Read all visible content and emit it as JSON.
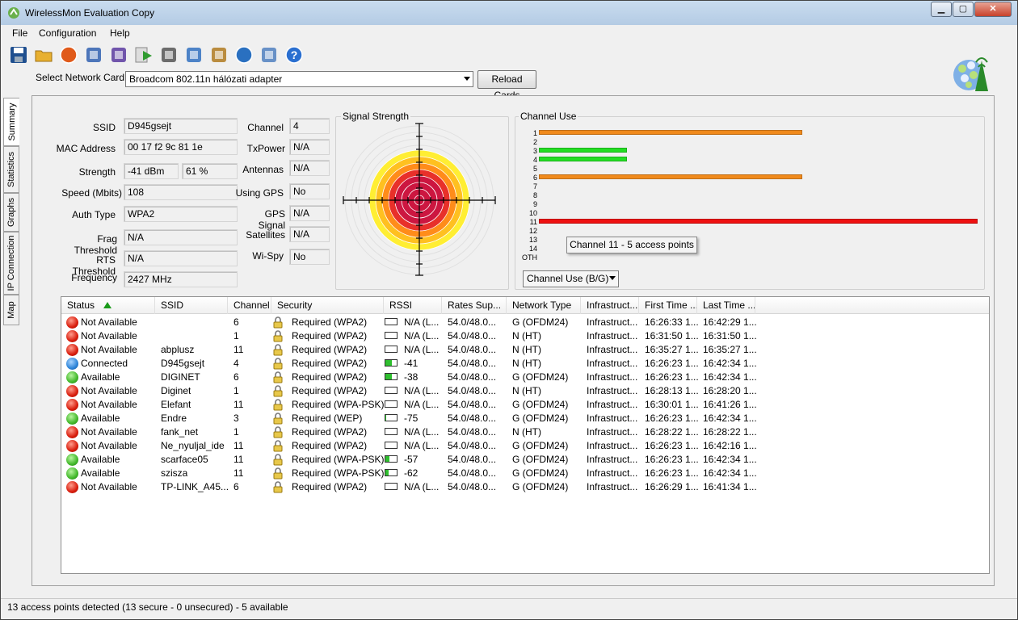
{
  "window": {
    "title": "WirelessMon Evaluation Copy",
    "min": "▁",
    "max": "▢",
    "close": "✕"
  },
  "menu": [
    "File",
    "Configuration",
    "Help"
  ],
  "toolbar": {
    "icons": [
      "save-icon",
      "open-folder-icon",
      "record-icon",
      "network-cards-icon",
      "network-cards-alt-icon",
      "play-icon",
      "print-icon",
      "checklist-icon",
      "clipboard-icon",
      "globe-icon",
      "info-bubble-icon",
      "help-icon"
    ]
  },
  "network_card": {
    "label": "Select Network Card",
    "value": "Broadcom 802.11n hálózati adapter",
    "reload": "Reload Cards"
  },
  "tabs": [
    "Summary",
    "Statistics",
    "Graphs",
    "IP Connection",
    "Map"
  ],
  "summary": {
    "ssid_label": "SSID",
    "ssid": "D945gsejt",
    "mac_label": "MAC Address",
    "mac": "00 17 f2 9c 81 1e",
    "strength_label": "Strength",
    "strength_dbm": "-41 dBm",
    "strength_pct": "61 %",
    "speed_label": "Speed (Mbits)",
    "speed": "108",
    "auth_label": "Auth Type",
    "auth": "WPA2",
    "frag_label": "Frag Threshold",
    "frag": "N/A",
    "rts_label": "RTS Threshold",
    "rts": "N/A",
    "freq_label": "Frequency",
    "freq": "2427 MHz",
    "channel_label": "Channel",
    "channel": "4",
    "txpower_label": "TxPower",
    "txpower": "N/A",
    "antennas_label": "Antennas",
    "antennas": "N/A",
    "gps_label": "Using GPS",
    "gps": "No",
    "gpssig_label": "GPS Signal",
    "gpssig": "N/A",
    "sat_label": "Satellites",
    "sat": "N/A",
    "wispy_label": "Wi-Spy",
    "wispy": "No"
  },
  "signal": {
    "title": "Signal Strength"
  },
  "channel_use": {
    "title": "Channel Use",
    "labels": [
      "1",
      "2",
      "3",
      "4",
      "5",
      "6",
      "7",
      "8",
      "9",
      "10",
      "11",
      "12",
      "13",
      "14",
      "OTH"
    ],
    "bars": [
      {
        "ch": "1",
        "count": 3,
        "color": "#f08a1c"
      },
      {
        "ch": "3",
        "count": 1,
        "color": "#22dd22"
      },
      {
        "ch": "4",
        "count": 1,
        "color": "#22dd22"
      },
      {
        "ch": "6",
        "count": 3,
        "color": "#f08a1c"
      },
      {
        "ch": "11",
        "count": 5,
        "color": "#ee1111"
      }
    ],
    "max_count": 5,
    "tooltip": "Channel 11 - 5 access points",
    "mode": "Channel Use (B/G)"
  },
  "list": {
    "columns": [
      "Status",
      "SSID",
      "Channel",
      "Security",
      "RSSI",
      "Rates Sup...",
      "Network Type",
      "Infrastruct...",
      "First Time ...",
      "Last Time ..."
    ],
    "rows": [
      {
        "st": "red",
        "status": "Not Available",
        "ssid": "",
        "ch": "6",
        "sec": "Required (WPA2)",
        "rssi_level": 0,
        "rssi": "N/A (L...",
        "rates": "54.0/48.0...",
        "net": "G (OFDM24)",
        "infra": "Infrastruct...",
        "first": "16:26:33 1...",
        "last": "16:42:29 1..."
      },
      {
        "st": "red",
        "status": "Not Available",
        "ssid": "",
        "ch": "1",
        "sec": "Required (WPA2)",
        "rssi_level": 0,
        "rssi": "N/A (L...",
        "rates": "54.0/48.0...",
        "net": "N (HT)",
        "infra": "Infrastruct...",
        "first": "16:31:50 1...",
        "last": "16:31:50 1..."
      },
      {
        "st": "red",
        "status": "Not Available",
        "ssid": "abplusz",
        "ch": "11",
        "sec": "Required (WPA2)",
        "rssi_level": 0,
        "rssi": "N/A (L...",
        "rates": "54.0/48.0...",
        "net": "N (HT)",
        "infra": "Infrastruct...",
        "first": "16:35:27 1...",
        "last": "16:35:27 1..."
      },
      {
        "st": "blue",
        "status": "Connected",
        "ssid": "D945gsejt",
        "ch": "4",
        "sec": "Required (WPA2)",
        "rssi_level": 0.6,
        "rssi": "-41",
        "rates": "54.0/48.0...",
        "net": "N (HT)",
        "infra": "Infrastruct...",
        "first": "16:26:23 1...",
        "last": "16:42:34 1..."
      },
      {
        "st": "green",
        "status": "Available",
        "ssid": "DIGINET",
        "ch": "6",
        "sec": "Required (WPA2)",
        "rssi_level": 0.55,
        "rssi": "-38",
        "rates": "54.0/48.0...",
        "net": "G (OFDM24)",
        "infra": "Infrastruct...",
        "first": "16:26:23 1...",
        "last": "16:42:34 1..."
      },
      {
        "st": "red",
        "status": "Not Available",
        "ssid": "Diginet",
        "ch": "1",
        "sec": "Required (WPA2)",
        "rssi_level": 0,
        "rssi": "N/A (L...",
        "rates": "54.0/48.0...",
        "net": "N (HT)",
        "infra": "Infrastruct...",
        "first": "16:28:13 1...",
        "last": "16:28:20 1..."
      },
      {
        "st": "red",
        "status": "Not Available",
        "ssid": "Elefant",
        "ch": "11",
        "sec": "Required (WPA-PSK)",
        "rssi_level": 0,
        "rssi": "N/A (L...",
        "rates": "54.0/48.0...",
        "net": "G (OFDM24)",
        "infra": "Infrastruct...",
        "first": "16:30:01 1...",
        "last": "16:41:26 1..."
      },
      {
        "st": "green",
        "status": "Available",
        "ssid": "Endre",
        "ch": "3",
        "sec": "Required (WEP)",
        "rssi_level": 0.1,
        "rssi": "-75",
        "rates": "54.0/48.0...",
        "net": "G (OFDM24)",
        "infra": "Infrastruct...",
        "first": "16:26:23 1...",
        "last": "16:42:34 1..."
      },
      {
        "st": "red",
        "status": "Not Available",
        "ssid": "fank_net",
        "ch": "1",
        "sec": "Required (WPA2)",
        "rssi_level": 0,
        "rssi": "N/A (L...",
        "rates": "54.0/48.0...",
        "net": "N (HT)",
        "infra": "Infrastruct...",
        "first": "16:28:22 1...",
        "last": "16:28:22 1..."
      },
      {
        "st": "red",
        "status": "Not Available",
        "ssid": "Ne_nyuljal_ide",
        "ch": "11",
        "sec": "Required (WPA2)",
        "rssi_level": 0,
        "rssi": "N/A (L...",
        "rates": "54.0/48.0...",
        "net": "G (OFDM24)",
        "infra": "Infrastruct...",
        "first": "16:26:23 1...",
        "last": "16:42:16 1..."
      },
      {
        "st": "green",
        "status": "Available",
        "ssid": "scarface05",
        "ch": "11",
        "sec": "Required (WPA-PSK)",
        "rssi_level": 0.35,
        "rssi": "-57",
        "rates": "54.0/48.0...",
        "net": "G (OFDM24)",
        "infra": "Infrastruct...",
        "first": "16:26:23 1...",
        "last": "16:42:34 1..."
      },
      {
        "st": "green",
        "status": "Available",
        "ssid": "szisza",
        "ch": "11",
        "sec": "Required (WPA-PSK)",
        "rssi_level": 0.3,
        "rssi": "-62",
        "rates": "54.0/48.0...",
        "net": "G (OFDM24)",
        "infra": "Infrastruct...",
        "first": "16:26:23 1...",
        "last": "16:42:34 1..."
      },
      {
        "st": "red",
        "status": "Not Available",
        "ssid": "TP-LINK_A45...",
        "ch": "6",
        "sec": "Required (WPA2)",
        "rssi_level": 0,
        "rssi": "N/A (L...",
        "rates": "54.0/48.0...",
        "net": "G (OFDM24)",
        "infra": "Infrastruct...",
        "first": "16:26:29 1...",
        "last": "16:41:34 1..."
      }
    ]
  },
  "statusbar": "13 access points detected (13 secure - 0 unsecured) - 5 available"
}
